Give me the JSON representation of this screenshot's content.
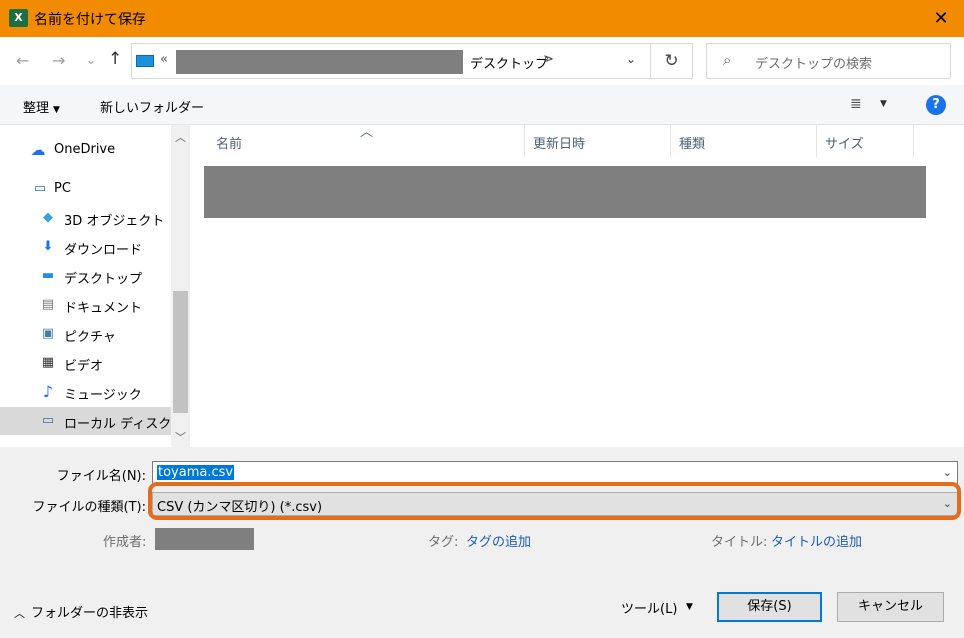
{
  "window": {
    "app_icon": "excel-icon",
    "title": "名前を付けて保存",
    "close": "✕"
  },
  "nav": {
    "back": "←",
    "forward": "→",
    "recent": "⌄",
    "up": "↑",
    "address_overflow": "«",
    "address_current": "デスクトップ",
    "address_separator": ">",
    "address_dropdown": "⌄",
    "refresh": "↻",
    "search_placeholder": "デスクトップの検索",
    "search_icon": "⌕"
  },
  "toolbar": {
    "organize": "整理",
    "organize_caret": "▼",
    "new_folder": "新しいフォルダー",
    "view_icon": "≣",
    "view_caret": "▼",
    "help": "?"
  },
  "sidebar": {
    "items": [
      {
        "label": "OneDrive",
        "icon": "cloud-icon",
        "glyph": "☁"
      },
      {
        "label": "PC",
        "icon": "pc-icon",
        "glyph": "▭"
      },
      {
        "label": "3D オブジェクト",
        "icon": "cube-icon",
        "glyph": "◆"
      },
      {
        "label": "ダウンロード",
        "icon": "download-icon",
        "glyph": "⬇"
      },
      {
        "label": "デスクトップ",
        "icon": "desktop-icon",
        "glyph": "▬"
      },
      {
        "label": "ドキュメント",
        "icon": "document-icon",
        "glyph": "▤"
      },
      {
        "label": "ピクチャ",
        "icon": "picture-icon",
        "glyph": "▣"
      },
      {
        "label": "ビデオ",
        "icon": "video-icon",
        "glyph": "▦"
      },
      {
        "label": "ミュージック",
        "icon": "music-icon",
        "glyph": "♪"
      },
      {
        "label": "ローカル ディスク (C",
        "icon": "disk-icon",
        "glyph": "▭"
      }
    ]
  },
  "columns": {
    "name": "名前",
    "modified": "更新日時",
    "type": "種類",
    "size": "サイズ"
  },
  "form": {
    "filename_label": "ファイル名(N):",
    "filename_value": "toyama.csv",
    "filetype_label": "ファイルの種類(T):",
    "filetype_value": "CSV (カンマ区切り) (*.csv)",
    "author_label": "作成者:",
    "tags_label": "タグ:",
    "tags_link": "タグの追加",
    "title_label": "タイトル:",
    "title_link": "タイトルの追加"
  },
  "footer": {
    "hide_folders": "フォルダーの非表示",
    "tools": "ツール(L)",
    "save": "保存(S)",
    "cancel": "キャンセル"
  },
  "colors": {
    "titlebar": "#f28b00",
    "highlight_border": "#e46c1c",
    "selection": "#0078d7",
    "link": "#1a5bb8"
  }
}
